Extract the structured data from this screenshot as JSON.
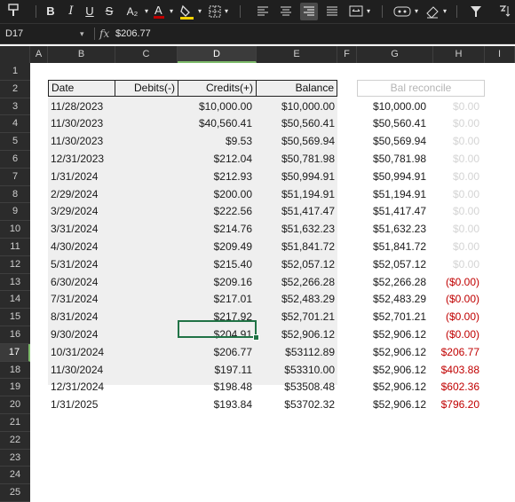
{
  "toolbar": {
    "buttons": [
      {
        "name": "format-painter-icon",
        "glyph": "🖌"
      },
      {
        "name": "bold-button",
        "glyph": "B"
      },
      {
        "name": "italic-button",
        "glyph": "I"
      },
      {
        "name": "underline-button",
        "glyph": "U"
      },
      {
        "name": "strikethrough-button",
        "glyph": "S"
      },
      {
        "name": "subscript-button",
        "glyph": "A₂"
      },
      {
        "name": "font-color-button",
        "glyph": "A"
      },
      {
        "name": "fill-color-button",
        "glyph": "◈"
      },
      {
        "name": "borders-button",
        "glyph": "⊞"
      }
    ]
  },
  "formula_bar": {
    "name_box": "D17",
    "fx": "fx",
    "value": "$206.77"
  },
  "columns": [
    "A",
    "B",
    "C",
    "D",
    "E",
    "F",
    "G",
    "H",
    "I"
  ],
  "rows": [
    "1",
    "2",
    "3",
    "4",
    "5",
    "6",
    "7",
    "8",
    "9",
    "10",
    "11",
    "12",
    "13",
    "14",
    "15",
    "16",
    "17",
    "18",
    "19",
    "20",
    "21",
    "22",
    "23",
    "24",
    "25"
  ],
  "table": {
    "headers": {
      "date": "Date",
      "debits": "Debits(-)",
      "credits": "Credits(+)",
      "balance": "Balance",
      "bal_reconcile": "Bal reconcile"
    },
    "rows": [
      {
        "date": "11/28/2023",
        "credits": "$10,000.00",
        "balance": "$10,000.00",
        "g": "$10,000.00",
        "h": "$0.00",
        "h_style": "light"
      },
      {
        "date": "11/30/2023",
        "credits": "$40,560.41",
        "balance": "$50,560.41",
        "g": "$50,560.41",
        "h": "$0.00",
        "h_style": "light"
      },
      {
        "date": "11/30/2023",
        "credits": "$9.53",
        "balance": "$50,569.94",
        "g": "$50,569.94",
        "h": "$0.00",
        "h_style": "light"
      },
      {
        "date": "12/31/2023",
        "credits": "$212.04",
        "balance": "$50,781.98",
        "g": "$50,781.98",
        "h": "$0.00",
        "h_style": "light"
      },
      {
        "date": "1/31/2024",
        "credits": "$212.93",
        "balance": "$50,994.91",
        "g": "$50,994.91",
        "h": "$0.00",
        "h_style": "light"
      },
      {
        "date": "2/29/2024",
        "credits": "$200.00",
        "balance": "$51,194.91",
        "g": "$51,194.91",
        "h": "$0.00",
        "h_style": "light"
      },
      {
        "date": "3/29/2024",
        "credits": "$222.56",
        "balance": "$51,417.47",
        "g": "$51,417.47",
        "h": "$0.00",
        "h_style": "light"
      },
      {
        "date": "3/31/2024",
        "credits": "$214.76",
        "balance": "$51,632.23",
        "g": "$51,632.23",
        "h": "$0.00",
        "h_style": "light"
      },
      {
        "date": "4/30/2024",
        "credits": "$209.49",
        "balance": "$51,841.72",
        "g": "$51,841.72",
        "h": "$0.00",
        "h_style": "light"
      },
      {
        "date": "5/31/2024",
        "credits": "$215.40",
        "balance": "$52,057.12",
        "g": "$52,057.12",
        "h": "$0.00",
        "h_style": "light"
      },
      {
        "date": "6/30/2024",
        "credits": "$209.16",
        "balance": "$52,266.28",
        "g": "$52,266.28",
        "h": "($0.00)",
        "h_style": "red"
      },
      {
        "date": "7/31/2024",
        "credits": "$217.01",
        "balance": "$52,483.29",
        "g": "$52,483.29",
        "h": "($0.00)",
        "h_style": "red"
      },
      {
        "date": "8/31/2024",
        "credits": "$217.92",
        "balance": "$52,701.21",
        "g": "$52,701.21",
        "h": "($0.00)",
        "h_style": "red"
      },
      {
        "date": "9/30/2024",
        "credits": "$204.91",
        "balance": "$52,906.12",
        "g": "$52,906.12",
        "h": "($0.00)",
        "h_style": "red"
      },
      {
        "date": "10/31/2024",
        "credits": "$206.77",
        "balance": "$53112.89",
        "g": "$52,906.12",
        "h": "$206.77",
        "h_style": "red"
      },
      {
        "date": "11/30/2024",
        "credits": "$197.11",
        "balance": "$53310.00",
        "g": "$52,906.12",
        "h": "$403.88",
        "h_style": "red"
      },
      {
        "date": "12/31/2024",
        "credits": "$198.48",
        "balance": "$53508.48",
        "g": "$52,906.12",
        "h": "$602.36",
        "h_style": "red"
      },
      {
        "date": "1/31/2025",
        "credits": "$193.84",
        "balance": "$53702.32",
        "g": "$52,906.12",
        "h": "$796.20",
        "h_style": "red"
      }
    ]
  },
  "colors": {
    "selection": "#217346",
    "header_bg": "#2b2b2b",
    "negative": "#c00000",
    "zero": "#d4d4d4"
  }
}
